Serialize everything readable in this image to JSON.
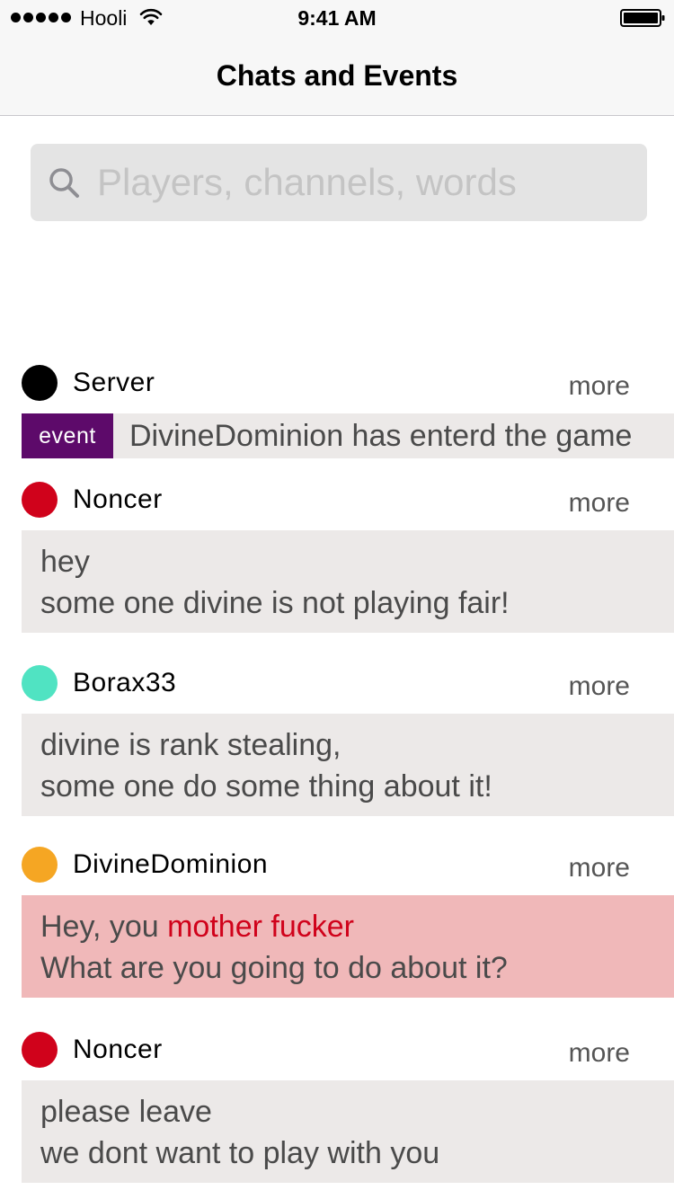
{
  "status_bar": {
    "carrier": "Hooli",
    "time": "9:41 AM"
  },
  "header": {
    "title": "Chats and Events"
  },
  "search": {
    "value": "",
    "placeholder": "Players, channels, words"
  },
  "colors": {
    "event_badge": "#5d0a6a",
    "flagged_bubble": "#f0b8b9",
    "flagged_text": "#d0021b",
    "bubble": "#ece9e8"
  },
  "feed": [
    {
      "user": "Server",
      "avatar_color": "#000000",
      "more": "more",
      "event_label": "event",
      "event_text": "DivineDominion has enterd the game"
    },
    {
      "user": "Noncer",
      "avatar_color": "#d0021b",
      "more": "more",
      "lines": [
        "hey",
        "some one divine is not playing fair!"
      ]
    },
    {
      "user": "Borax33",
      "avatar_color": "#50e3c2",
      "more": "more",
      "lines": [
        "divine is rank stealing,",
        "some one do some thing about it!"
      ]
    },
    {
      "user": "DivineDominion",
      "avatar_color": "#f5a623",
      "more": "more",
      "flagged": true,
      "line1_prefix": "Hey, you ",
      "line1_flagged": "mother fucker",
      "line2": "What are you going to do about it?"
    },
    {
      "user": "Noncer",
      "avatar_color": "#d0021b",
      "more": "more",
      "lines": [
        "please leave",
        "we dont want to play with you"
      ]
    }
  ]
}
